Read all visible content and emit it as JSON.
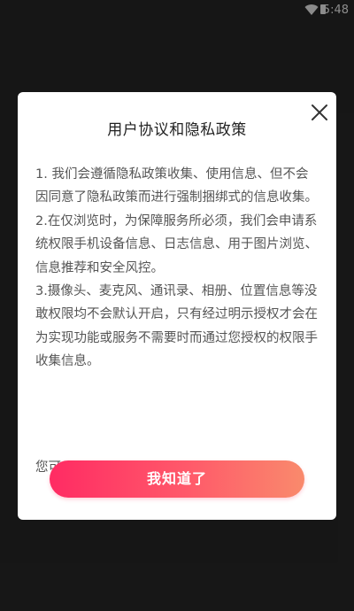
{
  "status_bar": {
    "time": "5:48",
    "icons": [
      "wifi-icon",
      "battery-icon"
    ]
  },
  "dialog": {
    "title": "用户协议和隐私政策",
    "close_icon": "close-icon",
    "paragraphs": [
      "1. 我们会遵循隐私政策收集、使用信息、但不会因同意了隐私政策而进行强制捆绑式的信息收集。",
      "2.在仅浏览时，为保障服务所必须，我们会申请系统权限手机设备信息、日志信息、用于图片浏览、信息推荐和安全风控。",
      "3.摄像头、麦克风、通讯录、相册、位置信息等没敢权限均不会默认开启，只有经过明示授权才会在为实现功能或服务不需要时而通过您授权的权限手收集信息。"
    ],
    "footer_partial": "您可",
    "confirm_label": "我知道了",
    "accent_gradient": [
      "#ff2b63",
      "#f98a6c"
    ]
  }
}
